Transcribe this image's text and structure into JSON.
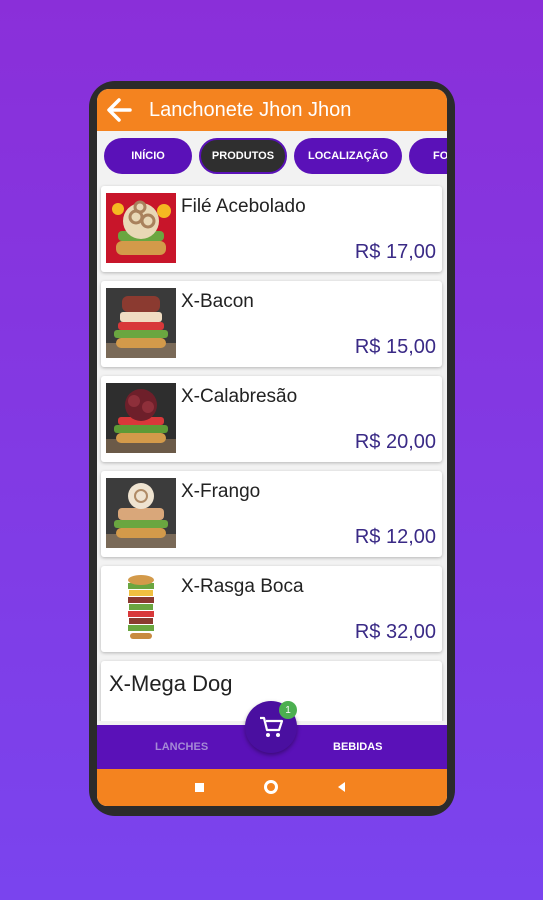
{
  "app": {
    "title": "Lanchonete Jhon Jhon"
  },
  "tabs": [
    {
      "label": "INÍCIO"
    },
    {
      "label": "PRODUTOS",
      "active": true
    },
    {
      "label": "LOCALIZAÇÃO"
    },
    {
      "label": "FO"
    }
  ],
  "products": [
    {
      "name": "Filé Acebolado",
      "price": "R$ 17,00"
    },
    {
      "name": "X-Bacon",
      "price": "R$ 15,00"
    },
    {
      "name": "X-Calabresão",
      "price": "R$ 20,00"
    },
    {
      "name": "X-Frango",
      "price": "R$ 12,00"
    },
    {
      "name": "X-Rasga Boca",
      "price": "R$ 32,00"
    }
  ],
  "partial_item": {
    "name": "X-Mega Dog"
  },
  "bottom_nav": {
    "lanches": "LANCHES",
    "bebidas": "BEBIDAS"
  },
  "cart": {
    "badge_count": "1"
  },
  "colors": {
    "accent": "#f4831f",
    "primary": "#5a11b8",
    "price": "#3a2a86"
  }
}
